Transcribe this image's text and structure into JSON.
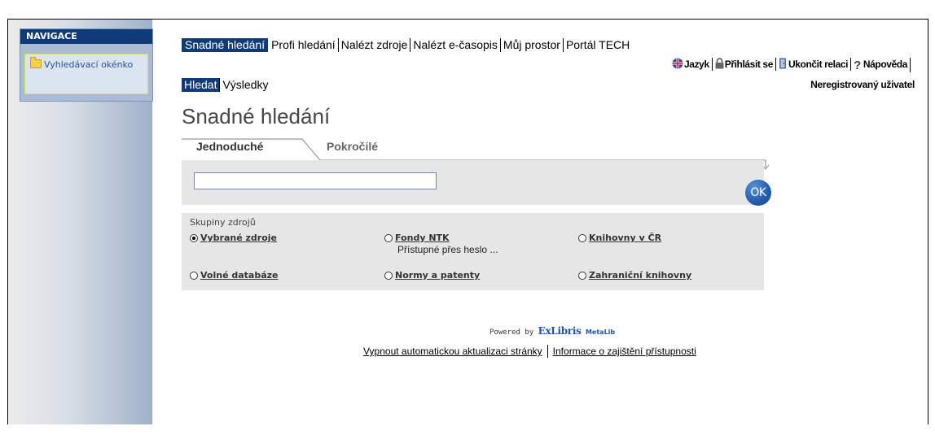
{
  "navigation": {
    "title": "NAVIGACE",
    "item": "Vyhledávací okénko"
  },
  "top_tabs": [
    {
      "label": "Snadné hledání",
      "active": true
    },
    {
      "label": "Profi hledání",
      "active": false
    },
    {
      "label": "Nalézt zdroje",
      "active": false
    },
    {
      "label": "Nalézt e-časopis",
      "active": false
    },
    {
      "label": "Můj prostor",
      "active": false
    },
    {
      "label": "Portál TECH",
      "active": false
    }
  ],
  "utility": {
    "language": "Jazyk",
    "login": "Přihlásit se",
    "logout": "Ukončit relaci",
    "help": "Nápověda"
  },
  "user_status": "Neregistrovaný uživatel",
  "sub_tabs": [
    {
      "label": "Hledat",
      "active": true
    },
    {
      "label": "Výsledky",
      "active": false
    }
  ],
  "page_title": "Snadné hledání",
  "search_tabs": {
    "simple": "Jednoduché",
    "advanced": "Pokročilé"
  },
  "search": {
    "value": "",
    "ok_label": "OK"
  },
  "groups": {
    "label": "Skupiny zdrojů",
    "options": [
      {
        "label": "Vybrané zdroje",
        "selected": true,
        "note": ""
      },
      {
        "label": "Fondy NTK",
        "selected": false,
        "note": "Přístupné přes heslo ..."
      },
      {
        "label": "Knihovny v ČR",
        "selected": false,
        "note": ""
      },
      {
        "label": "Volné databáze",
        "selected": false,
        "note": ""
      },
      {
        "label": "Normy a patenty",
        "selected": false,
        "note": ""
      },
      {
        "label": "Zahraniční knihovny",
        "selected": false,
        "note": ""
      }
    ]
  },
  "powered": {
    "text": "Powered by",
    "brand": "ExLibris",
    "product": "MetaLib"
  },
  "footer": {
    "link1": "Vypnout automatickou aktualizaci stránky",
    "link2": "Informace o zajištění přístupnosti"
  },
  "colors": {
    "nav_blue": "#0f3b78",
    "ok_button": "#245eae",
    "panel_gray": "#e6e6e6"
  }
}
